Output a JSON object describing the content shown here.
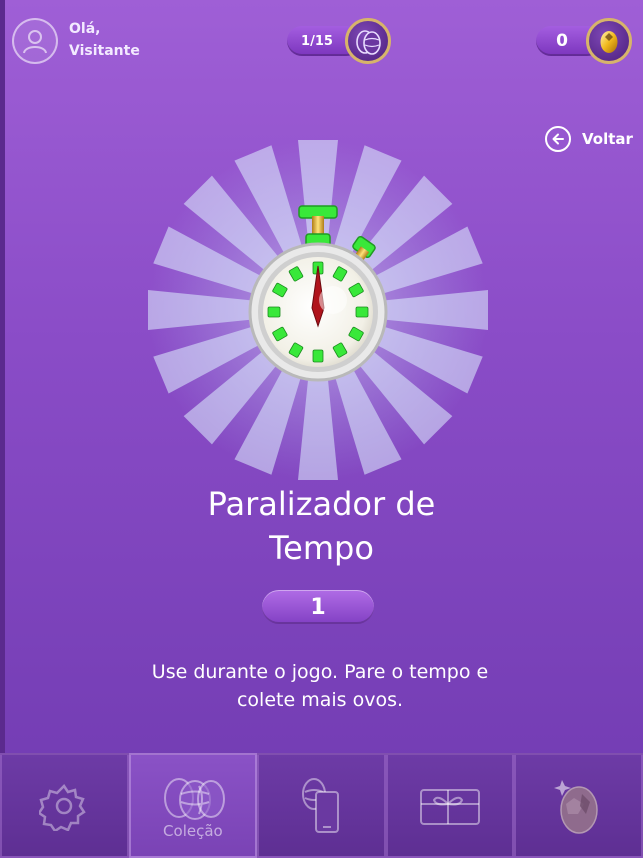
{
  "header": {
    "greeting_line1": "Olá,",
    "greeting_line2": "Visitante",
    "eggs_counter": "1/15",
    "gold_counter": "0"
  },
  "back_label": "Voltar",
  "item": {
    "title_line1": "Paralizador de",
    "title_line2": "Tempo",
    "quantity": "1",
    "description_line1": "Use durante o jogo. Pare o tempo e",
    "description_line2": "colete mais ovos."
  },
  "nav": {
    "settings_icon": "gear-icon",
    "collection_label": "Coleção",
    "items": [
      "settings",
      "collection",
      "mobile-eggs",
      "gift-shop",
      "golden-egg"
    ]
  },
  "colors": {
    "background_top": "#9f5fd6",
    "background_bottom": "#6f3ab0",
    "accent_green": "#39e83a",
    "hand_red": "#b0141c",
    "gold_ring": "#d7b46a"
  }
}
